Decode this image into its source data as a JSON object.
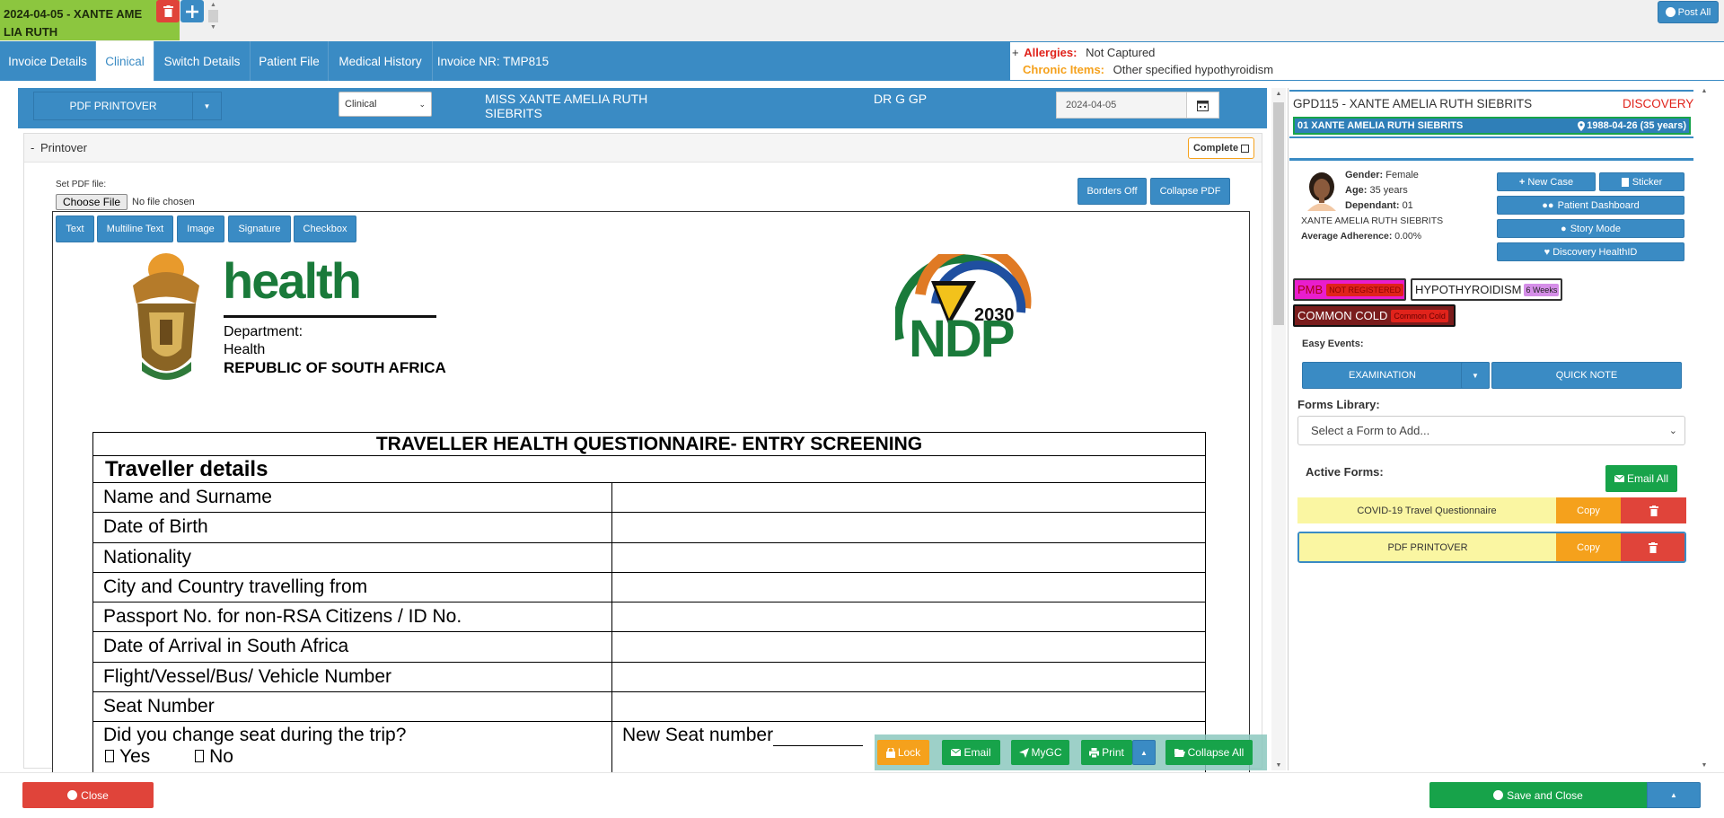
{
  "topbar": {
    "patient_tab_label_line1": "2024-04-05 - XANTE AME",
    "patient_tab_label_line2": "LIA RUTH",
    "post_all_label": "Post All"
  },
  "nav": {
    "tabs": [
      "Invoice Details",
      "Clinical",
      "Switch Details",
      "Patient File",
      "Medical History",
      "Invoice NR: TMP815"
    ],
    "allergies_label": "Allergies:",
    "allergies_value": "Not Captured",
    "chronic_label": "Chronic Items:",
    "chronic_value": "Other specified hypothyroidism",
    "plus": "+"
  },
  "form_header": {
    "form_select": "PDF PRINTOVER",
    "type_select": "Clinical",
    "patient_name": "MISS XANTE AMELIA RUTH SIEBRITS",
    "doctor": "DR G GP",
    "date": "2024-04-05"
  },
  "printover": {
    "title": "Printover",
    "collapse_symbol": "-",
    "complete_label": "Complete",
    "set_pdf_label": "Set PDF file:",
    "choose_file_label": "Choose File",
    "no_file_label": "No file chosen",
    "borders_off_label": "Borders Off",
    "collapse_pdf_label": "Collapse PDF",
    "tools": [
      "Text",
      "Multiline Text",
      "Image",
      "Signature",
      "Checkbox"
    ]
  },
  "pdf": {
    "health_word": "health",
    "department_lines": [
      "Department:",
      "Health",
      "REPUBLIC OF SOUTH AFRICA"
    ],
    "ndp_year": "2030",
    "ndp_text": "NDP",
    "doc_title": "TRAVELLER HEALTH QUESTIONNAIRE- ENTRY SCREENING",
    "section_title": "Traveller details",
    "rows": [
      "Name and Surname",
      "Date of Birth",
      "Nationality",
      "City and Country travelling from",
      "Passport No. for non-RSA Citizens / ID No.",
      "Date of Arrival in South Africa",
      "Flight/Vessel/Bus/ Vehicle Number",
      "Seat Number"
    ],
    "seat_change_question": "Did you change seat during the trip?",
    "yes_label": "Yes",
    "no_label": "No",
    "new_seat_label": "New Seat number"
  },
  "floating_actions": {
    "lock": "Lock",
    "email": "Email",
    "mygc": "MyGC",
    "print": "Print",
    "collapse_all": "Collapse All"
  },
  "right_panel": {
    "patient_header": "GPD115 - XANTE AMELIA RUTH SIEBRITS",
    "scheme": "DISCOVERY",
    "dependant_bar": "01 XANTE AMELIA RUTH SIEBRITS",
    "dob": "1988-04-26 (35 years)",
    "gender_label": "Gender:",
    "gender_value": "Female",
    "age_label": "Age:",
    "age_value": "35 years",
    "dependant_label": "Dependant:",
    "dependant_value": "01",
    "full_name": "XANTE AMELIA RUTH SIEBRITS",
    "adherence_label": "Average Adherence:",
    "adherence_value": "0.00%",
    "buttons": {
      "new_case": "New Case",
      "sticker": "Sticker",
      "patient_dashboard": "Patient Dashboard",
      "story_mode": "Story Mode",
      "discovery_healthid": "Discovery HealthID"
    },
    "tags": [
      {
        "name": "PMB",
        "badge": "NOT REGISTERED"
      },
      {
        "name": "HYPOTHYROIDISM",
        "badge": "6 Weeks"
      },
      {
        "name": "COMMON COLD",
        "badge": "Common Cold"
      }
    ],
    "easy_events_label": "Easy Events:",
    "examination_label": "EXAMINATION",
    "quick_note_label": "QUICK NOTE",
    "forms_library_label": "Forms Library:",
    "forms_select_placeholder": "Select a Form to Add...",
    "active_forms_label": "Active Forms:",
    "email_all_label": "Email All",
    "active_forms": [
      {
        "name": "COVID-19 Travel Questionnaire",
        "copy": "Copy"
      },
      {
        "name": "PDF PRINTOVER",
        "copy": "Copy"
      }
    ]
  },
  "footer": {
    "close_label": "Close",
    "save_close_label": "Save and Close"
  },
  "colors": {
    "primary": "#3a8bc4",
    "green": "#17a34a",
    "orange": "#f5a11c",
    "red": "#e0443a",
    "patient_tab": "#8cc63f"
  }
}
